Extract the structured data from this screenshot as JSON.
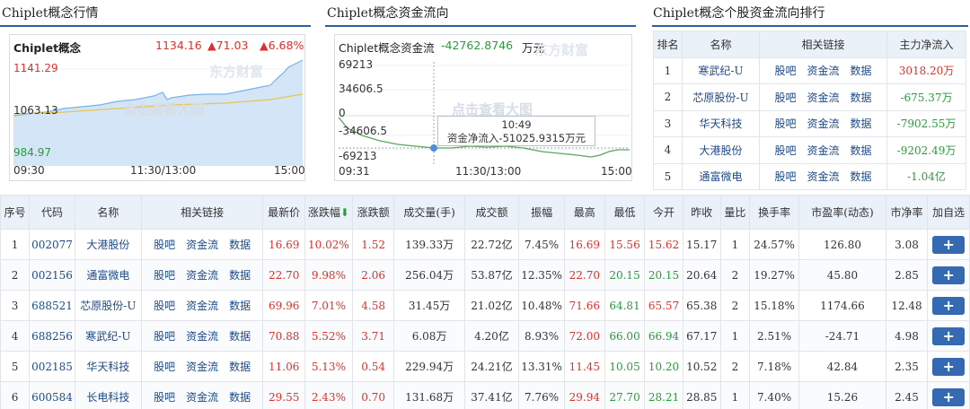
{
  "panels": {
    "market_title": "Chiplet概念行情",
    "flow_title": "Chiplet概念资金流向",
    "rank_title": "Chiplet概念个股资金流向排行"
  },
  "market_chart": {
    "name": "Chiplet概念",
    "price": "1134.16",
    "change": "▲71.03",
    "change_pct": "▲6.68%",
    "y_high": "1141.29",
    "y_mid": "1063.13",
    "y_low": "984.97",
    "x_start": "09:30",
    "x_mid": "11:30/13:00",
    "x_end": "15:00",
    "watermark": "东方财富",
    "hint": "点击查看大图"
  },
  "flow_chart": {
    "name": "Chiplet概念资金流",
    "value": "-42762.8746",
    "unit": "万元",
    "y1": "69213",
    "y2": "34606.5",
    "y3": "0",
    "y4": "-34606.5",
    "y5": "-69213",
    "x_start": "09:31",
    "x_mid": "11:30/13:00",
    "x_end": "15:00",
    "tooltip_time": "10:49",
    "tooltip_text": "资金净流入-51025.9315万元",
    "watermark": "东方财富",
    "hint": "点击查看大图"
  },
  "rank_table": {
    "headers": [
      "排名",
      "名称",
      "相关链接",
      "主力净流入"
    ],
    "links": [
      "股吧",
      "资金流",
      "数据"
    ],
    "rows": [
      {
        "rank": "1",
        "name": "寒武纪-U",
        "flow": "3018.20万"
      },
      {
        "rank": "2",
        "name": "芯原股份-U",
        "flow": "-675.37万"
      },
      {
        "rank": "3",
        "name": "华天科技",
        "flow": "-7902.55万"
      },
      {
        "rank": "4",
        "name": "大港股份",
        "flow": "-9202.49万"
      },
      {
        "rank": "5",
        "name": "通富微电",
        "flow": "-1.04亿"
      }
    ]
  },
  "main_table": {
    "headers": [
      "序号",
      "代码",
      "名称",
      "相关链接",
      "最新价",
      "涨跌幅",
      "涨跌额",
      "成交量(手)",
      "成交额",
      "振幅",
      "最高",
      "最低",
      "今开",
      "昨收",
      "量比",
      "换手率",
      "市盈率(动态)",
      "市净率",
      "加自选"
    ],
    "sort_arrow": "⬇",
    "links": [
      "股吧",
      "资金流",
      "数据"
    ],
    "add_label": "+",
    "rows": [
      {
        "no": "1",
        "code": "002077",
        "name": "大港股份",
        "price": "16.69",
        "pct": "10.02%",
        "chg": "1.52",
        "vol": "139.33万",
        "amt": "22.72亿",
        "amp": "7.45%",
        "high": "16.69",
        "low": "15.56",
        "open": "15.62",
        "prev": "15.17",
        "vr": "1",
        "turn": "24.57%",
        "pe": "126.80",
        "pb": "3.08"
      },
      {
        "no": "2",
        "code": "002156",
        "name": "通富微电",
        "price": "22.70",
        "pct": "9.98%",
        "chg": "2.06",
        "vol": "256.04万",
        "amt": "53.87亿",
        "amp": "12.35%",
        "high": "22.70",
        "low": "20.15",
        "open": "20.15",
        "prev": "20.64",
        "vr": "2",
        "turn": "19.27%",
        "pe": "45.80",
        "pb": "2.85"
      },
      {
        "no": "3",
        "code": "688521",
        "name": "芯原股份-U",
        "price": "69.96",
        "pct": "7.01%",
        "chg": "4.58",
        "vol": "31.45万",
        "amt": "21.02亿",
        "amp": "10.48%",
        "high": "71.66",
        "low": "64.81",
        "open": "65.57",
        "prev": "65.38",
        "vr": "2",
        "turn": "15.18%",
        "pe": "1174.66",
        "pb": "12.48"
      },
      {
        "no": "4",
        "code": "688256",
        "name": "寒武纪-U",
        "price": "70.88",
        "pct": "5.52%",
        "chg": "3.71",
        "vol": "6.08万",
        "amt": "4.20亿",
        "amp": "8.93%",
        "high": "72.00",
        "low": "66.00",
        "open": "66.94",
        "prev": "67.17",
        "vr": "1",
        "turn": "2.51%",
        "pe": "-24.71",
        "pb": "4.98"
      },
      {
        "no": "5",
        "code": "002185",
        "name": "华天科技",
        "price": "11.06",
        "pct": "5.13%",
        "chg": "0.54",
        "vol": "229.94万",
        "amt": "24.21亿",
        "amp": "13.31%",
        "high": "11.45",
        "low": "10.05",
        "open": "10.20",
        "prev": "10.52",
        "vr": "2",
        "turn": "7.18%",
        "pe": "42.84",
        "pb": "2.35"
      },
      {
        "no": "6",
        "code": "600584",
        "name": "长电科技",
        "price": "29.55",
        "pct": "2.43%",
        "chg": "0.70",
        "vol": "131.68万",
        "amt": "37.41亿",
        "amp": "7.76%",
        "high": "29.94",
        "low": "27.70",
        "open": "28.21",
        "prev": "28.85",
        "vr": "1",
        "turn": "7.40%",
        "pe": "15.26",
        "pb": "2.45"
      }
    ]
  }
}
